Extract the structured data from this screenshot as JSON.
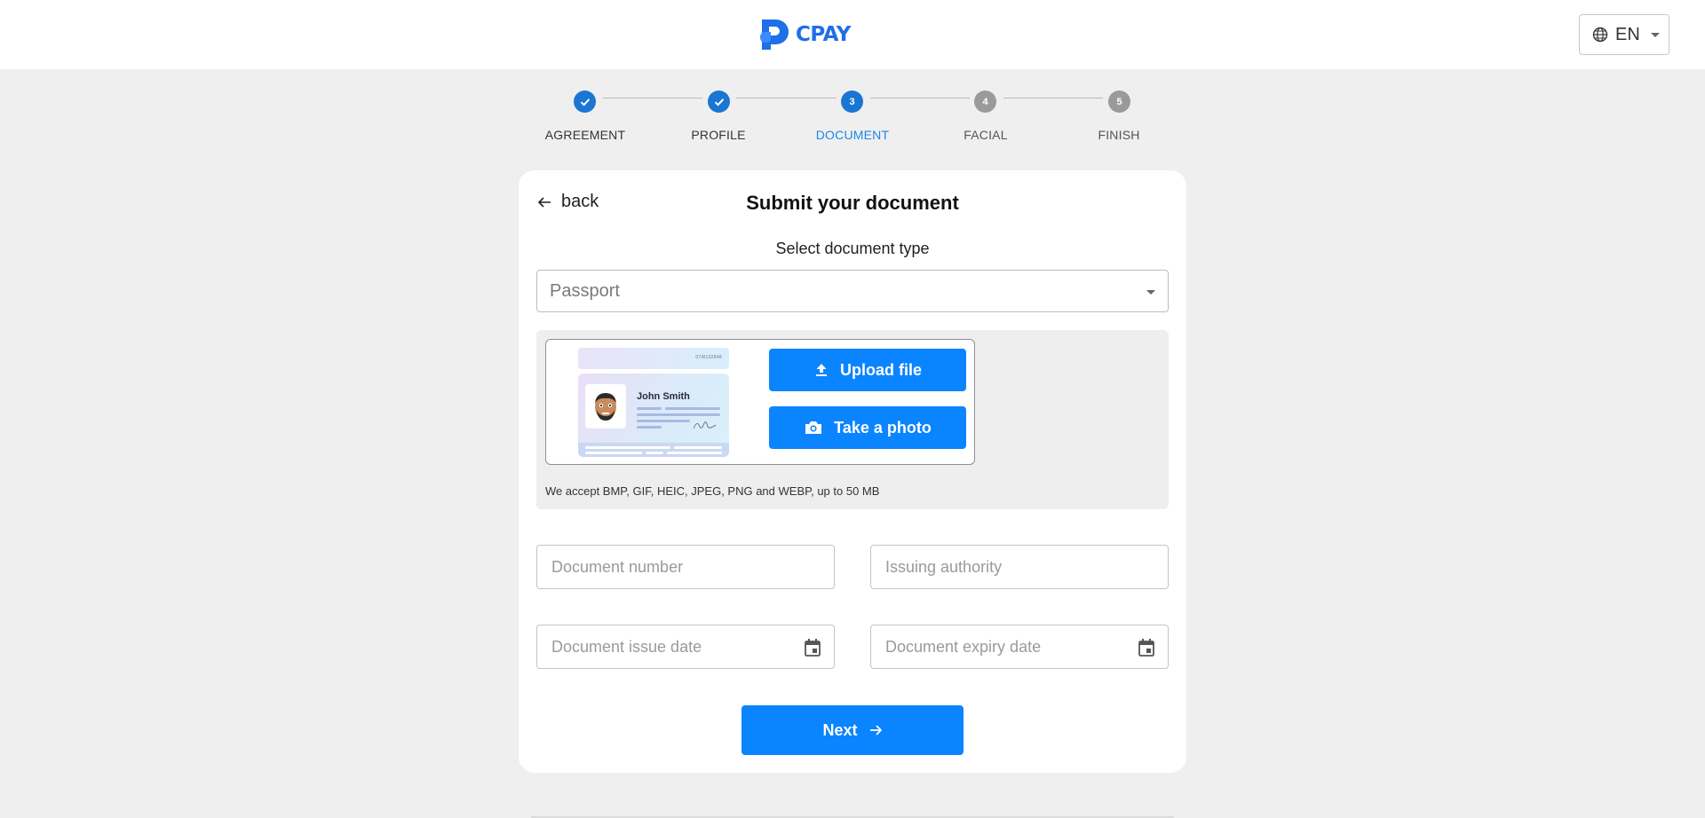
{
  "header": {
    "brand": "CPAY",
    "language": "EN"
  },
  "stepper": {
    "steps": [
      {
        "label": "AGREEMENT",
        "state": "done",
        "number": ""
      },
      {
        "label": "PROFILE",
        "state": "done",
        "number": ""
      },
      {
        "label": "DOCUMENT",
        "state": "active",
        "number": "3"
      },
      {
        "label": "FACIAL",
        "state": "todo",
        "number": "4"
      },
      {
        "label": "FINISH",
        "state": "todo",
        "number": "5"
      }
    ]
  },
  "form": {
    "back_label": "back",
    "title": "Submit your document",
    "doc_type_label": "Select document type",
    "doc_type_value": "Passport",
    "sample_card": {
      "name": "John Smith",
      "number": "07W102848"
    },
    "upload_label": "Upload file",
    "photo_label": "Take a photo",
    "formats_note": "We accept BMP, GIF, HEIC, JPEG, PNG and WEBP, up to 50 MB",
    "fields": {
      "doc_number_placeholder": "Document number",
      "issuing_authority_placeholder": "Issuing authority",
      "issue_date_placeholder": "Document issue date",
      "expiry_date_placeholder": "Document expiry date"
    },
    "next_label": "Next"
  },
  "colors": {
    "primary": "#0a84ff",
    "step_active": "#1976d2",
    "step_todo": "#9a9a9a",
    "brand": "#1e6fe8"
  }
}
